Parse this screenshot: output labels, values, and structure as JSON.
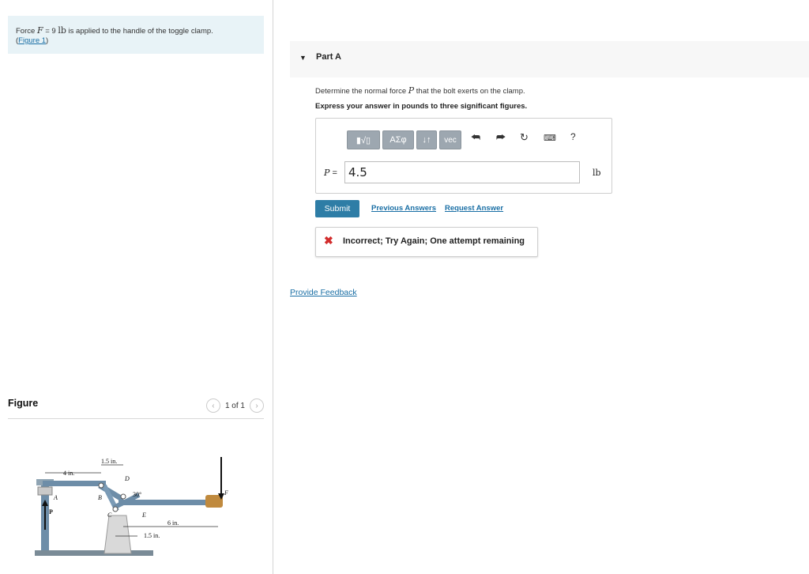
{
  "problem": {
    "text_prefix": "Force ",
    "var_F": "F",
    "equals": " = 9 ",
    "unit": "lb",
    "text_suffix": " is applied to the handle of the toggle clamp.",
    "figure_link_open": "(",
    "figure_link": "Figure 1",
    "figure_link_close": ")"
  },
  "figure_panel": {
    "title": "Figure",
    "page_indicator": "1 of 1",
    "prev_icon": "chevron-left-icon",
    "next_icon": "chevron-right-icon",
    "labels": {
      "dim_4in": "4 in.",
      "dim_15in_top": "1.5 in.",
      "dim_15in_bottom": "1.5 in.",
      "dim_6in": "6 in.",
      "angle": "30°",
      "A": "A",
      "B": "B",
      "C": "C",
      "D": "D",
      "E": "E",
      "F": "F",
      "P": "P"
    }
  },
  "part": {
    "title": "Part A",
    "question_prefix": "Determine the normal force ",
    "question_var": "P",
    "question_suffix": " that the bolt exerts on the clamp.",
    "instruction": "Express your answer in pounds to three significant figures."
  },
  "toolbar": {
    "templates_label": "▮√▯",
    "greek_label": "ΑΣφ",
    "arrows_label": "↓↑",
    "vec_label": "vec",
    "undo_icon": "undo-icon",
    "redo_icon": "redo-icon",
    "reset_icon": "reset-icon",
    "keyboard_icon": "keyboard-icon",
    "help_label": "?"
  },
  "answer": {
    "variable": "P",
    "equals": " =",
    "value": "4.5",
    "unit": "lb"
  },
  "actions": {
    "submit": "Submit",
    "previous_answers": "Previous Answers",
    "request_answer": "Request Answer"
  },
  "feedback": {
    "icon": "x-icon",
    "message": "Incorrect; Try Again; One attempt remaining",
    "color": "#d22c2c"
  },
  "footer": {
    "provide_feedback": "Provide Feedback"
  },
  "colors": {
    "accent": "#2e7da6",
    "link": "#1a6fa5",
    "problem_bg": "#e8f3f7",
    "toolbar_button": "#9da7b0"
  }
}
